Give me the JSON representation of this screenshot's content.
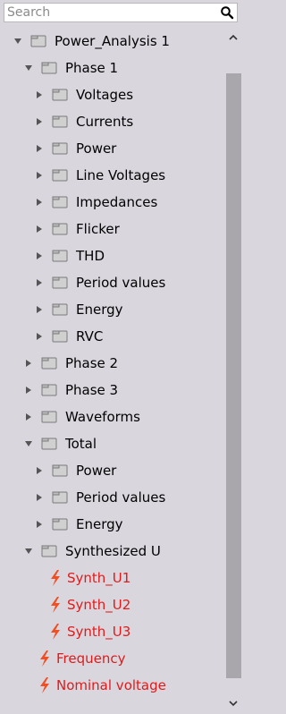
{
  "search": {
    "placeholder": "Search",
    "value": ""
  },
  "tree": {
    "items": [
      {
        "label": "Power_Analysis 1",
        "type": "folder",
        "state": "expanded"
      },
      {
        "label": "Phase 1",
        "type": "folder",
        "state": "expanded"
      },
      {
        "label": "Voltages",
        "type": "folder",
        "state": "collapsed"
      },
      {
        "label": "Currents",
        "type": "folder",
        "state": "collapsed"
      },
      {
        "label": "Power",
        "type": "folder",
        "state": "collapsed"
      },
      {
        "label": "Line Voltages",
        "type": "folder",
        "state": "collapsed"
      },
      {
        "label": "Impedances",
        "type": "folder",
        "state": "collapsed"
      },
      {
        "label": "Flicker",
        "type": "folder",
        "state": "collapsed"
      },
      {
        "label": "THD",
        "type": "folder",
        "state": "collapsed"
      },
      {
        "label": "Period values",
        "type": "folder",
        "state": "collapsed"
      },
      {
        "label": "Energy",
        "type": "folder",
        "state": "collapsed"
      },
      {
        "label": "RVC",
        "type": "folder",
        "state": "collapsed"
      },
      {
        "label": "Phase 2",
        "type": "folder",
        "state": "collapsed"
      },
      {
        "label": "Phase 3",
        "type": "folder",
        "state": "collapsed"
      },
      {
        "label": "Waveforms",
        "type": "folder",
        "state": "collapsed"
      },
      {
        "label": "Total",
        "type": "folder",
        "state": "expanded"
      },
      {
        "label": "Power",
        "type": "folder",
        "state": "collapsed"
      },
      {
        "label": "Period values",
        "type": "folder",
        "state": "collapsed"
      },
      {
        "label": "Energy",
        "type": "folder",
        "state": "collapsed"
      },
      {
        "label": "Synthesized U",
        "type": "folder",
        "state": "expanded"
      },
      {
        "label": "Synth_U1",
        "type": "channel"
      },
      {
        "label": "Synth_U2",
        "type": "channel"
      },
      {
        "label": "Synth_U3",
        "type": "channel"
      },
      {
        "label": "Frequency",
        "type": "channel"
      },
      {
        "label": "Nominal voltage",
        "type": "channel"
      }
    ]
  },
  "icons": {
    "search": "magnifier-icon",
    "expanded": "triangle-down-icon",
    "collapsed": "triangle-right-icon",
    "folder": "folder-icon",
    "channel": "lightning-bolt-icon",
    "scroll_up": "chevron-up-icon",
    "scroll_down": "chevron-down-icon"
  },
  "colors": {
    "background": "#d9d6de",
    "channel_text": "#e01b1b",
    "bolt": "#f04e23",
    "folder": "#d0d0d0",
    "arrow": "#555555",
    "scroll_thumb": "#a9a7ab"
  }
}
